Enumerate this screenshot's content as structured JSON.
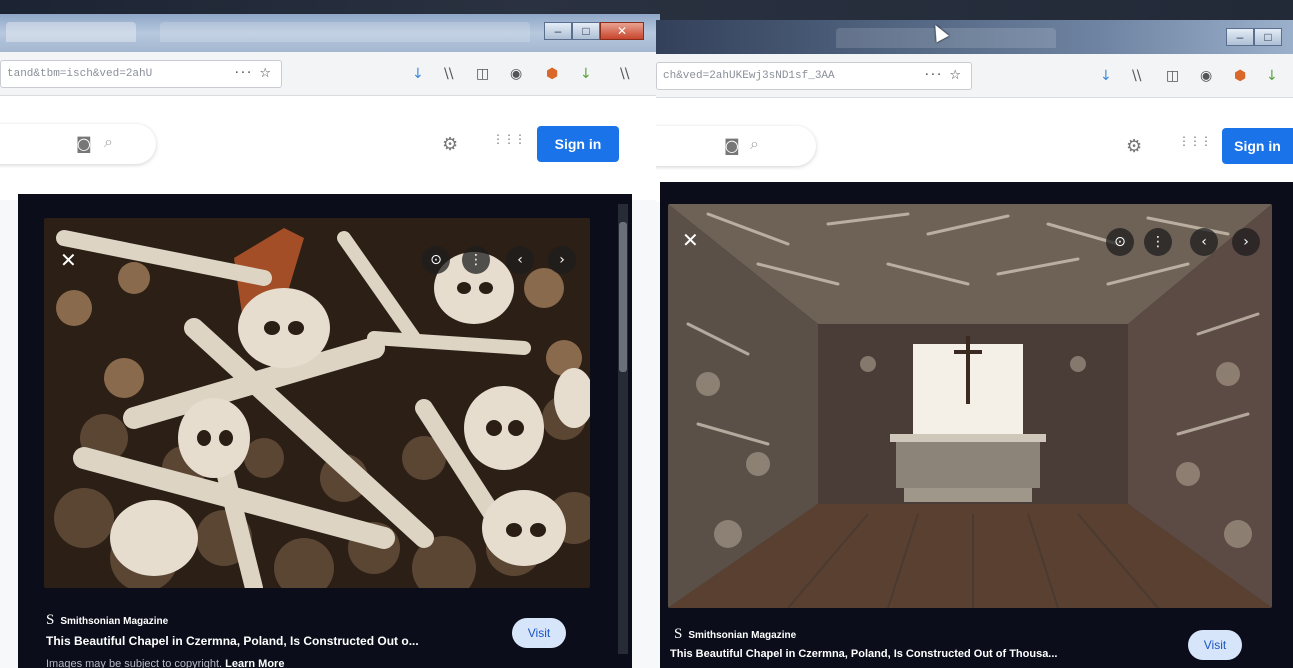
{
  "left_window": {
    "url_text": "tand&tbm=isch&ved=2ahU",
    "url_menu": "···",
    "signin_label": "Sign in",
    "source_name": "Smithsonian Magazine",
    "source_logo": "S",
    "title": "This Beautiful Chapel in Czermna, Poland, Is Constructed Out o...",
    "copyright_text": "Images may be subject to copyright.",
    "learn_more": "Learn More",
    "visit_label": "Visit",
    "close_glyph": "✕"
  },
  "right_window": {
    "url_text": "ch&ved=2ahUKEwj3sND1sf_3AA",
    "url_menu": "···",
    "signin_label": "Sign in",
    "source_name": "Smithsonian Magazine",
    "source_logo": "S",
    "title": "This Beautiful Chapel in Czermna, Poland, Is Constructed Out of Thousa...",
    "visit_label": "Visit",
    "close_glyph": "✕"
  },
  "icons": {
    "download": "↓",
    "library": "\\\\",
    "sidebar": "◫",
    "extension": "◉",
    "shield": "⬢",
    "star": "☆",
    "camera": "◙",
    "search": "⌕",
    "settings": "⚙",
    "apps": "⋮⋮⋮",
    "lens": "⊙",
    "more": "⋮",
    "prev": "‹",
    "next": "›",
    "minimize": "–",
    "maximize": "□",
    "close": "✕"
  },
  "colors": {
    "signin_bg": "#1a73e8",
    "panel_bg": "#0b0e1a",
    "visit_bg": "#d7e5fb"
  }
}
